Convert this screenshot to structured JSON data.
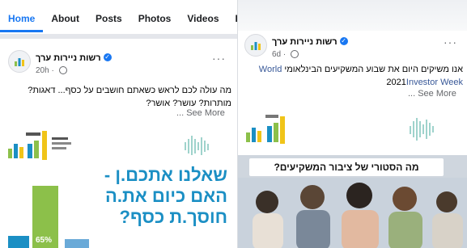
{
  "left_panel": {
    "tabs": [
      {
        "label": "Home",
        "active": true
      },
      {
        "label": "About"
      },
      {
        "label": "Posts"
      },
      {
        "label": "Photos"
      },
      {
        "label": "Videos"
      },
      {
        "label": "Ev"
      }
    ],
    "post": {
      "page_name": "רשות ניירות ערך",
      "time": "20h",
      "more": "···",
      "text_line1": "מה עולה לכם לראש כשאתם חושבים על כסף... דאגות?",
      "text_line2": "מותרות? עושר? אושר?",
      "see_more": "... See More",
      "image": {
        "headline1": "שאלנו אתכם.ן -",
        "headline2": "האם כיום את.ה",
        "headline3": "חוסך.ת כסף?",
        "bar_label": "65%",
        "brand_colors": {
          "teal": "#1b8fc4",
          "green": "#8cc04a",
          "blue": "#6aaad8",
          "yellow": "#f0c419"
        }
      }
    }
  },
  "right_panel": {
    "post": {
      "page_name": "רשות ניירות ערך",
      "time": "6d",
      "more": "···",
      "text_line1_rtl": "אנו משיקים היום את שבוע המשקיעים הבינלאומי",
      "text_line1_en": "World",
      "text_line2_en": "Investor Week",
      "text_line2_year": "2021",
      "see_more": "... See More",
      "image": {
        "question": "מה הסטורי של ציבור המשקיעים?"
      }
    }
  }
}
